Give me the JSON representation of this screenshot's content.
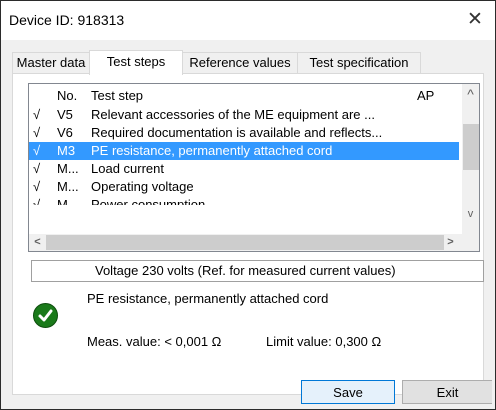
{
  "window": {
    "title": "Device ID: 918313",
    "close_glyph": "✕"
  },
  "tabs": [
    {
      "label": "Master data",
      "active": false
    },
    {
      "label": "Test steps",
      "active": true
    },
    {
      "label": "Reference values",
      "active": false
    },
    {
      "label": "Test specification",
      "active": false
    }
  ],
  "list": {
    "headers": {
      "check": "",
      "no": "No.",
      "step": "Test step",
      "ap": "AP"
    },
    "rows": [
      {
        "check": "√",
        "no": "V5",
        "step": "Relevant accessories of the ME equipment are ...",
        "ap": "",
        "selected": false
      },
      {
        "check": "√",
        "no": "V6",
        "step": "Required documentation is available and reflects...",
        "ap": "",
        "selected": false
      },
      {
        "check": "√",
        "no": "M3",
        "step": "PE resistance, permanently attached cord",
        "ap": "",
        "selected": true
      },
      {
        "check": "√",
        "no": "M...",
        "step": "Load current",
        "ap": "",
        "selected": false
      },
      {
        "check": "√",
        "no": "M...",
        "step": "Operating voltage",
        "ap": "",
        "selected": false
      },
      {
        "check": "√",
        "no": "M...",
        "step": "Power consumption",
        "ap": "",
        "selected": false
      }
    ],
    "scroll_up": "^",
    "scroll_down": "v",
    "scroll_left": "<",
    "scroll_right": ">"
  },
  "reference_info": "Voltage 230 volts (Ref. for measured current values)",
  "detail": {
    "title": "PE resistance, permanently attached cord",
    "status": "passed",
    "status_color": "#1a7a1a",
    "meas_value": "Meas. value: < 0,001 Ω",
    "limit_value": "Limit value: 0,300 Ω"
  },
  "buttons": {
    "save": "Save",
    "exit": "Exit"
  }
}
